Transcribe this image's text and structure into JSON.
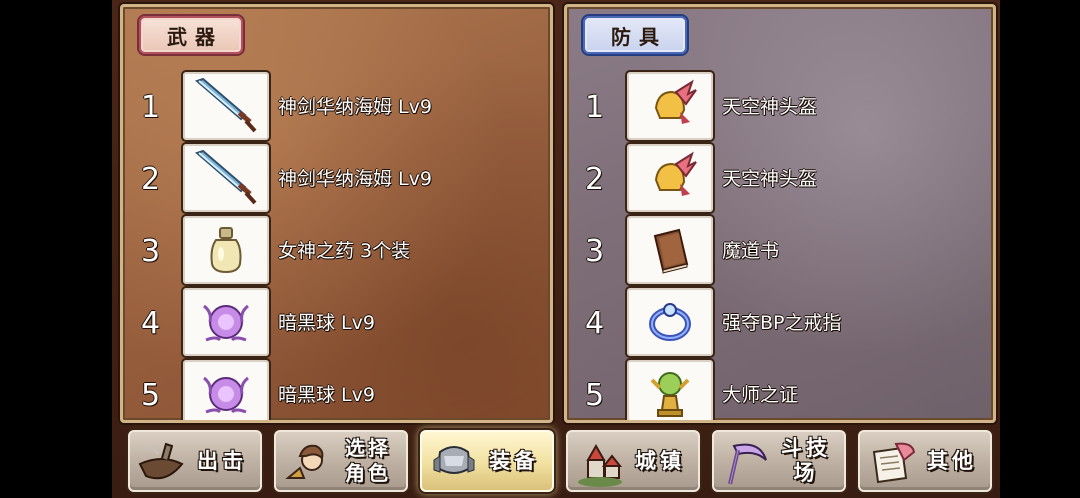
{
  "weapons": {
    "title": "武器",
    "items": [
      {
        "num": "1",
        "name": "神剑华纳海姆 Lv9",
        "icon": "sword-icon"
      },
      {
        "num": "2",
        "name": "神剑华纳海姆 Lv9",
        "icon": "sword-icon"
      },
      {
        "num": "3",
        "name": "女神之药 3个装",
        "icon": "potion-bottle-icon"
      },
      {
        "num": "4",
        "name": "暗黑球 Lv9",
        "icon": "dark-orb-icon"
      },
      {
        "num": "5",
        "name": "暗黑球 Lv9",
        "icon": "dark-orb-icon"
      }
    ]
  },
  "armor": {
    "title": "防具",
    "items": [
      {
        "num": "1",
        "name": "天空神头盔",
        "icon": "winged-helmet-icon"
      },
      {
        "num": "2",
        "name": "天空神头盔",
        "icon": "winged-helmet-icon"
      },
      {
        "num": "3",
        "name": "魔道书",
        "icon": "spellbook-icon"
      },
      {
        "num": "4",
        "name": "强夺BP之戒指",
        "icon": "ring-icon"
      },
      {
        "num": "5",
        "name": "大师之证",
        "icon": "master-trophy-icon"
      }
    ]
  },
  "nav": {
    "attack": "出击",
    "select_line1": "选择",
    "select_line2": "角色",
    "equip": "装备",
    "town": "城镇",
    "arena": "斗技场",
    "other": "其他"
  },
  "active_tab": "equip"
}
